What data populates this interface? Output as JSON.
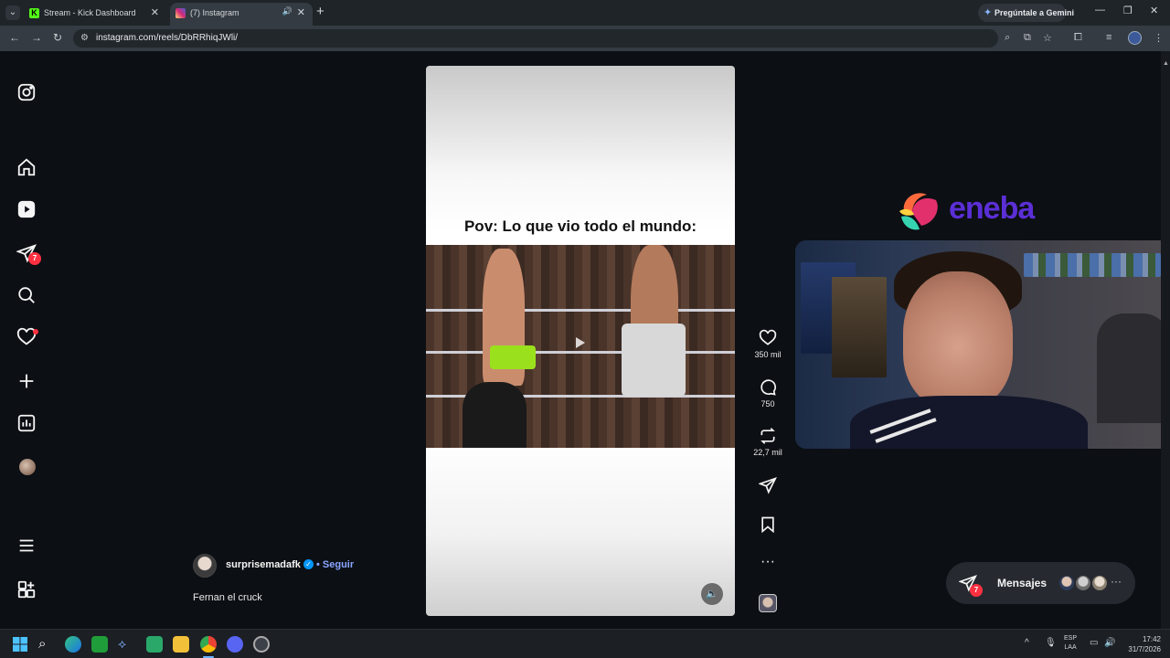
{
  "browser": {
    "tabs": [
      {
        "title": "Stream - Kick Dashboard",
        "favicon_color": "#53fc18",
        "favicon": "K"
      },
      {
        "title": "(7) Instagram",
        "favicon_color": "#d6249f"
      }
    ],
    "gemini_label": "Pregúntale a Gemini",
    "url": "instagram.com/reels/DbRRhiqJWli/"
  },
  "sidebar": {
    "items": [
      {
        "name": "instagram-logo-icon"
      },
      {
        "name": "home-icon"
      },
      {
        "name": "reels-icon"
      },
      {
        "name": "messages-icon",
        "badge": "7"
      },
      {
        "name": "search-icon"
      },
      {
        "name": "notifications-icon"
      },
      {
        "name": "create-icon"
      },
      {
        "name": "dashboard-icon"
      },
      {
        "name": "profile-avatar"
      },
      {
        "name": "menu-icon"
      },
      {
        "name": "also-from-meta-icon"
      }
    ]
  },
  "reel": {
    "caption_overlay": "Pov: Lo que vio todo el mundo:",
    "owner": "surprisemadafk",
    "follow_label": "• Seguir",
    "description": "Fernan el cruck",
    "likes": "350 mil",
    "comments": "750",
    "reposts": "22,7 mil"
  },
  "overlay": {
    "brand": "eneba",
    "brand_color": "#5b2fd6"
  },
  "messages_bar": {
    "label": "Mensajes",
    "badge": "7"
  },
  "taskbar": {
    "lang_top": "ESP",
    "lang_bottom": "LAA",
    "time": "17:42",
    "date": "31/7/2026"
  }
}
